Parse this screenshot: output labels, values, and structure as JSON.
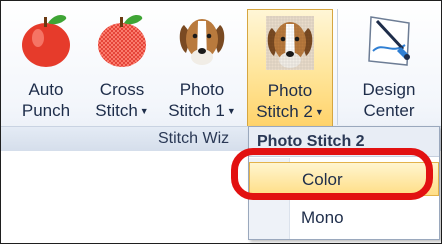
{
  "ribbon": {
    "buttons": [
      {
        "line1": "Auto",
        "line2": "Punch",
        "icon": "apple-icon",
        "has_arrow": false
      },
      {
        "line1": "Cross",
        "line2": "Stitch",
        "icon": "cross-stitch-apple-icon",
        "has_arrow": true
      },
      {
        "line1": "Photo",
        "line2": "Stitch 1",
        "icon": "dog-photo-icon",
        "has_arrow": true
      },
      {
        "line1": "Photo",
        "line2": "Stitch 2",
        "icon": "dog-photo-mosaic-icon",
        "has_arrow": true
      },
      {
        "line1": "Design",
        "line2": "Center",
        "icon": "design-center-icon",
        "has_arrow": false
      }
    ],
    "group_label": "Stitch Wiz"
  },
  "dropdown": {
    "header": "Photo Stitch 2",
    "items": [
      "Color",
      "Mono"
    ],
    "selected_index": 0
  },
  "colors": {
    "highlight": "#e21111",
    "selected_bg": "#ffde86"
  }
}
